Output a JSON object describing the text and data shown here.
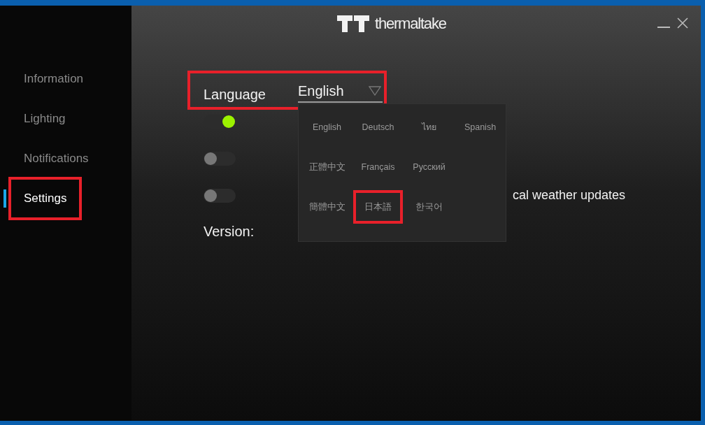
{
  "window": {
    "logo_text": "thermaltake"
  },
  "sidebar": {
    "items": [
      {
        "label": "Information",
        "selected": false,
        "highlighted": false
      },
      {
        "label": "Lighting",
        "selected": false,
        "highlighted": false
      },
      {
        "label": "Notifications",
        "selected": false,
        "highlighted": false
      },
      {
        "label": "Settings",
        "selected": true,
        "highlighted": true
      }
    ]
  },
  "settings": {
    "language": {
      "label": "Language",
      "value": "English",
      "highlighted": true,
      "expanded": true
    },
    "toggles": [
      {
        "on": true
      },
      {
        "on": false
      },
      {
        "label": "cal weather updates",
        "on": false
      }
    ],
    "version": {
      "label": "Version:"
    }
  },
  "language_menu": {
    "rows": [
      [
        {
          "label": "English",
          "highlighted": false
        },
        {
          "label": "Deutsch",
          "highlighted": false
        },
        {
          "label": "ไทย",
          "highlighted": false
        },
        {
          "label": "Spanish",
          "highlighted": false
        }
      ],
      [
        {
          "label": "正體中文",
          "highlighted": false
        },
        {
          "label": "Français",
          "highlighted": false
        },
        {
          "label": "Русский",
          "highlighted": false
        }
      ],
      [
        {
          "label": "簡體中文",
          "highlighted": false
        },
        {
          "label": "日本語",
          "highlighted": true
        },
        {
          "label": "한국어",
          "highlighted": false
        }
      ]
    ]
  }
}
